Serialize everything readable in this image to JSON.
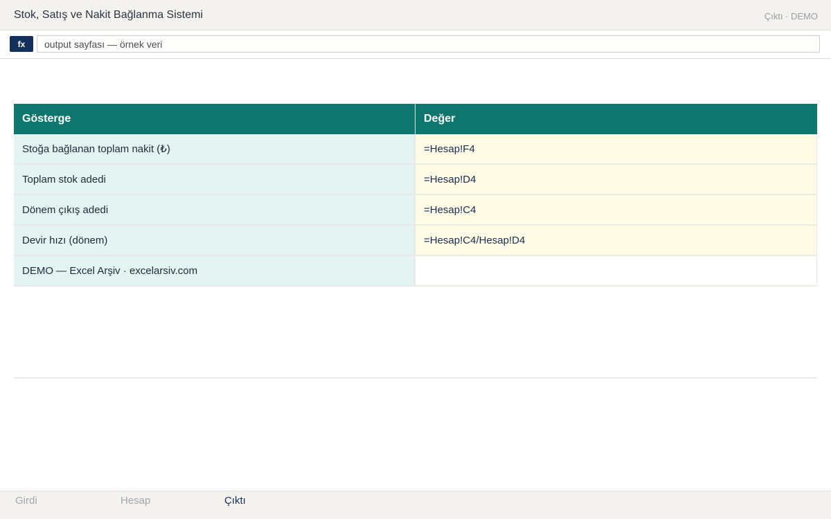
{
  "window": {
    "title": "Stok, Satış ve Nakit Bağlanma Sistemi",
    "meta": "Çıktı · DEMO"
  },
  "formula_bar": {
    "fx_label": "fx",
    "value": "output sayfası — örnek veri"
  },
  "table": {
    "headers": [
      "Gösterge",
      "Değer"
    ],
    "rows": [
      {
        "label": "Stoğa bağlanan toplam nakit (₺)",
        "value": "=Hesap!F4"
      },
      {
        "label": "Toplam stok adedi",
        "value": "=Hesap!D4"
      },
      {
        "label": "Dönem çıkış adedi",
        "value": "=Hesap!C4"
      },
      {
        "label": "Devir hızı (dönem)",
        "value": "=Hesap!C4/Hesap!D4"
      },
      {
        "label": "DEMO — Excel Arşiv · excelarsiv.com",
        "value": ""
      }
    ]
  },
  "tabs": [
    {
      "label": "Girdi",
      "active": false
    },
    {
      "label": "Hesap",
      "active": false
    },
    {
      "label": "Çıktı",
      "active": true
    }
  ],
  "colors": {
    "header_bg": "#0f766e",
    "label_cell_bg": "#e4f4f2",
    "value_cell_bg": "#fefce7",
    "fx_bg": "#12305a"
  }
}
